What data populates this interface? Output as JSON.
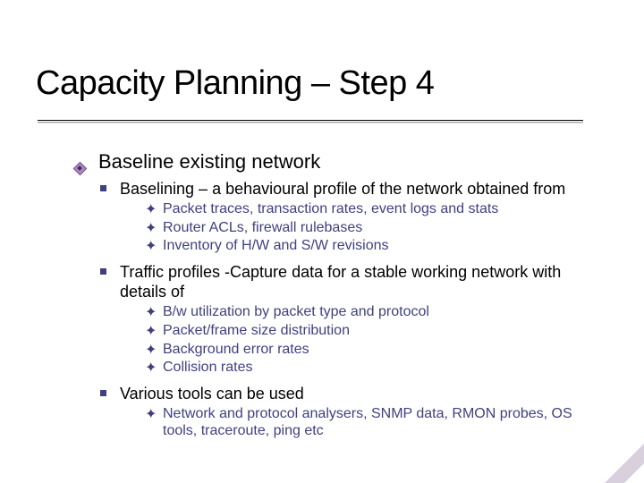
{
  "title": "Capacity Planning – Step 4",
  "l1": {
    "text": "Baseline existing network",
    "items": [
      {
        "text": "Baselining – a behavioural profile of the network obtained from",
        "sub": [
          "Packet traces, transaction rates, event logs and stats",
          "Router ACLs, firewall rulebases",
          "Inventory of H/W and S/W revisions"
        ]
      },
      {
        "text": "Traffic profiles -Capture data for a stable working network with details of",
        "sub": [
          "B/w utilization  by packet type and protocol",
          "Packet/frame size distribution",
          "Background error rates",
          "Collision rates"
        ]
      },
      {
        "text": "Various tools can be used",
        "sub": [
          "Network and protocol analysers, SNMP data, RMON probes, OS tools, traceroute, ping etc"
        ]
      }
    ]
  }
}
